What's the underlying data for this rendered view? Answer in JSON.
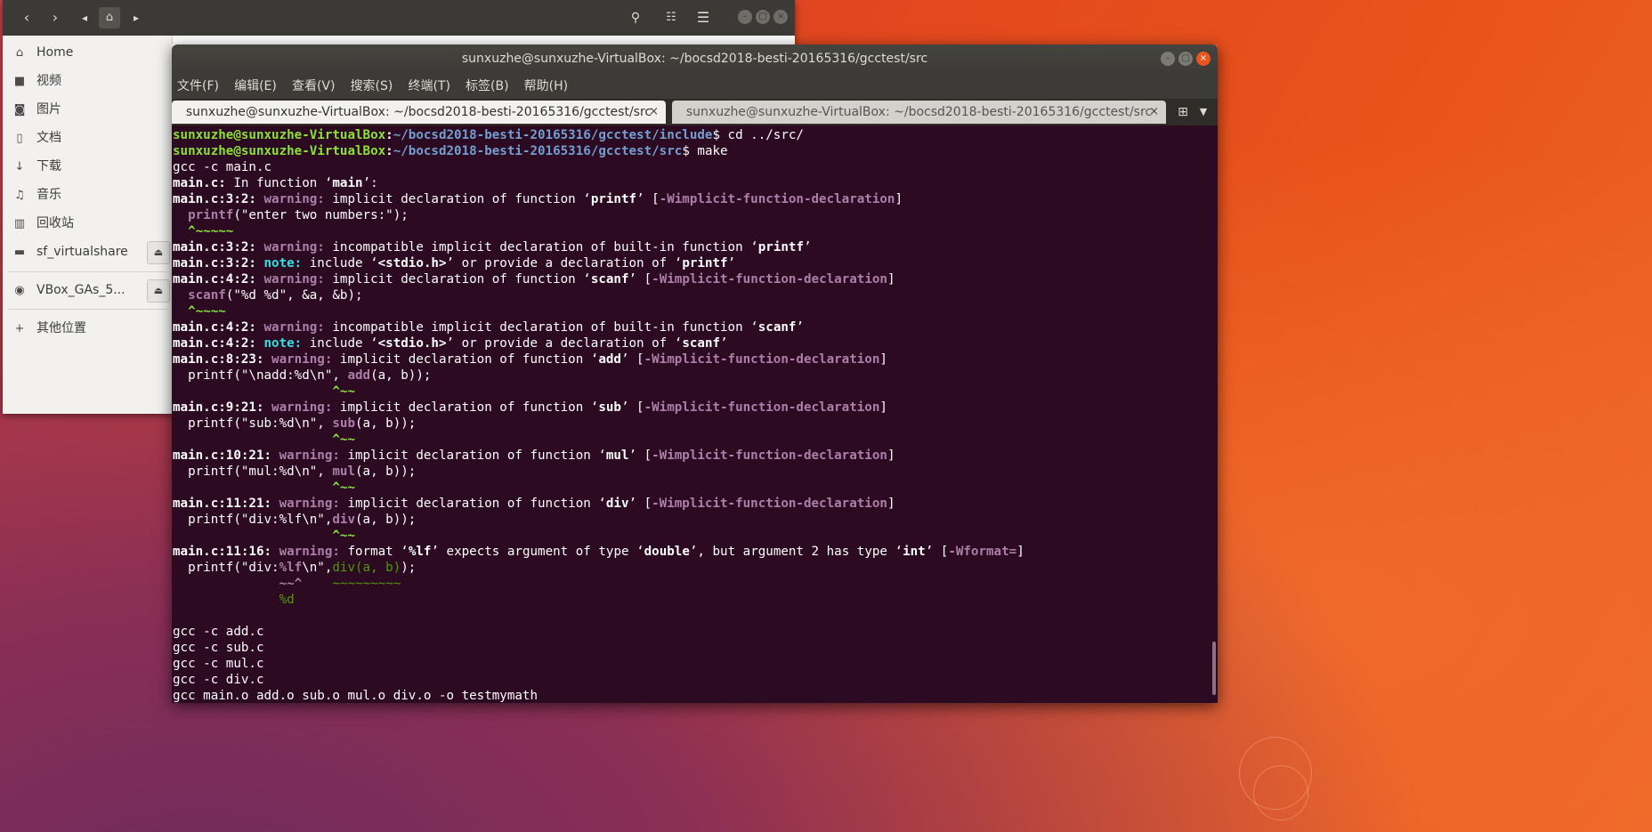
{
  "file_manager": {
    "sidebar_items": [
      {
        "label": "Home",
        "icon": "home-icon"
      },
      {
        "label": "视频",
        "icon": "video-icon"
      },
      {
        "label": "图片",
        "icon": "camera-icon"
      },
      {
        "label": "文档",
        "icon": "document-icon"
      },
      {
        "label": "下载",
        "icon": "download-icon"
      },
      {
        "label": "音乐",
        "icon": "music-icon"
      },
      {
        "label": "回收站",
        "icon": "trash-icon"
      },
      {
        "label": "sf_virtualshare",
        "icon": "drive-icon"
      },
      {
        "label": "VBox_GAs_5...",
        "icon": "disc-icon"
      },
      {
        "label": "其他位置",
        "icon": "plus-icon"
      }
    ]
  },
  "terminal": {
    "title": "sunxuzhe@sunxuzhe-VirtualBox: ~/bocsd2018-besti-20165316/gcctest/src",
    "menu": [
      "文件(F)",
      "编辑(E)",
      "查看(V)",
      "搜索(S)",
      "终端(T)",
      "标签(B)",
      "帮助(H)"
    ],
    "tabs": [
      {
        "label": "sunxuzhe@sunxuzhe-VirtualBox: ~/bocsd2018-besti-20165316/gcctest/src"
      },
      {
        "label": "sunxuzhe@sunxuzhe-VirtualBox: ~/bocsd2018-besti-20165316/gcctest/src"
      }
    ],
    "prompt_user": "sunxuzhe@sunxuzhe-VirtualBox",
    "path_include": "~/bocsd2018-besti-20165316/gcctest/include",
    "path_src": "~/bocsd2018-besti-20165316/gcctest/src",
    "cmd_cd": " cd ../src/",
    "cmd_make": " make",
    "lines": {
      "gcc_main": "gcc -c main.c",
      "in_function": " In function ",
      "q_main": "main",
      "func_printf": "printf",
      "func_scanf": "scanf",
      "func_add": "add",
      "func_sub": "sub",
      "func_mul": "mul",
      "func_div": "div",
      "loc_3_2": "main.c:3:2:",
      "loc_4_2": "main.c:4:2:",
      "loc_8_23": "main.c:8:23:",
      "loc_9_21": "main.c:9:21:",
      "loc_10_21": "main.c:10:21:",
      "loc_11_21": "main.c:11:21:",
      "loc_11_16": "main.c:11:16:",
      "warning": " warning:",
      "note": " note:",
      "implicit_decl": " implicit declaration of function ",
      "incompatible": " incompatible implicit declaration of built-in function ",
      "include_txt": " include ",
      "stdio": "<stdio.h>",
      "or_provide": " or provide a declaration of ",
      "flag_implicit": "-Wimplicit-function-declaration",
      "flag_format": "-Wformat=",
      "src_printf_rest": "(\"enter two numbers:\");",
      "src_scanf_rest": "(\"%d %d\", &a, &b);",
      "src_add_pre": "  printf(\"\\nadd:%d\\n\", ",
      "src_sub_pre": "  printf(\"sub:%d\\n\", ",
      "src_mul_pre": "  printf(\"mul:%d\\n\", ",
      "src_div_pre": "  printf(\"div:%lf\\n\",",
      "args": "(a, b));",
      "caret_printf": "  ^~~~~~",
      "caret_scanf": "  ^~~~~",
      "caret_add": "                     ^~~",
      "caret_sub": "                     ^~~",
      "caret_mul": "                     ^~~",
      "caret_div": "                     ^~~",
      "format_txt": " format ",
      "pct_lf": "%lf",
      "expects": " expects argument of type ",
      "double_t": "double",
      "but_arg": ", but argument 2 has type ",
      "int_t": "int",
      "src_fmt_pre": "  printf(\"div:",
      "src_fmt_post": "\\n\",",
      "src_fmt_div": "div(a, b)",
      "src_fmt_end": ");",
      "caret_fmt": "              ~~^",
      "tilde_fmt": "    ~~~~~~~~~",
      "fix_pct_d": "              %d",
      "gcc_add": "gcc -c add.c",
      "gcc_sub": "gcc -c sub.c",
      "gcc_mul": "gcc -c mul.c",
      "gcc_div": "gcc -c div.c",
      "gcc_link": "gcc main.o add.o sub.o mul.o div.o -o testmymath"
    }
  }
}
